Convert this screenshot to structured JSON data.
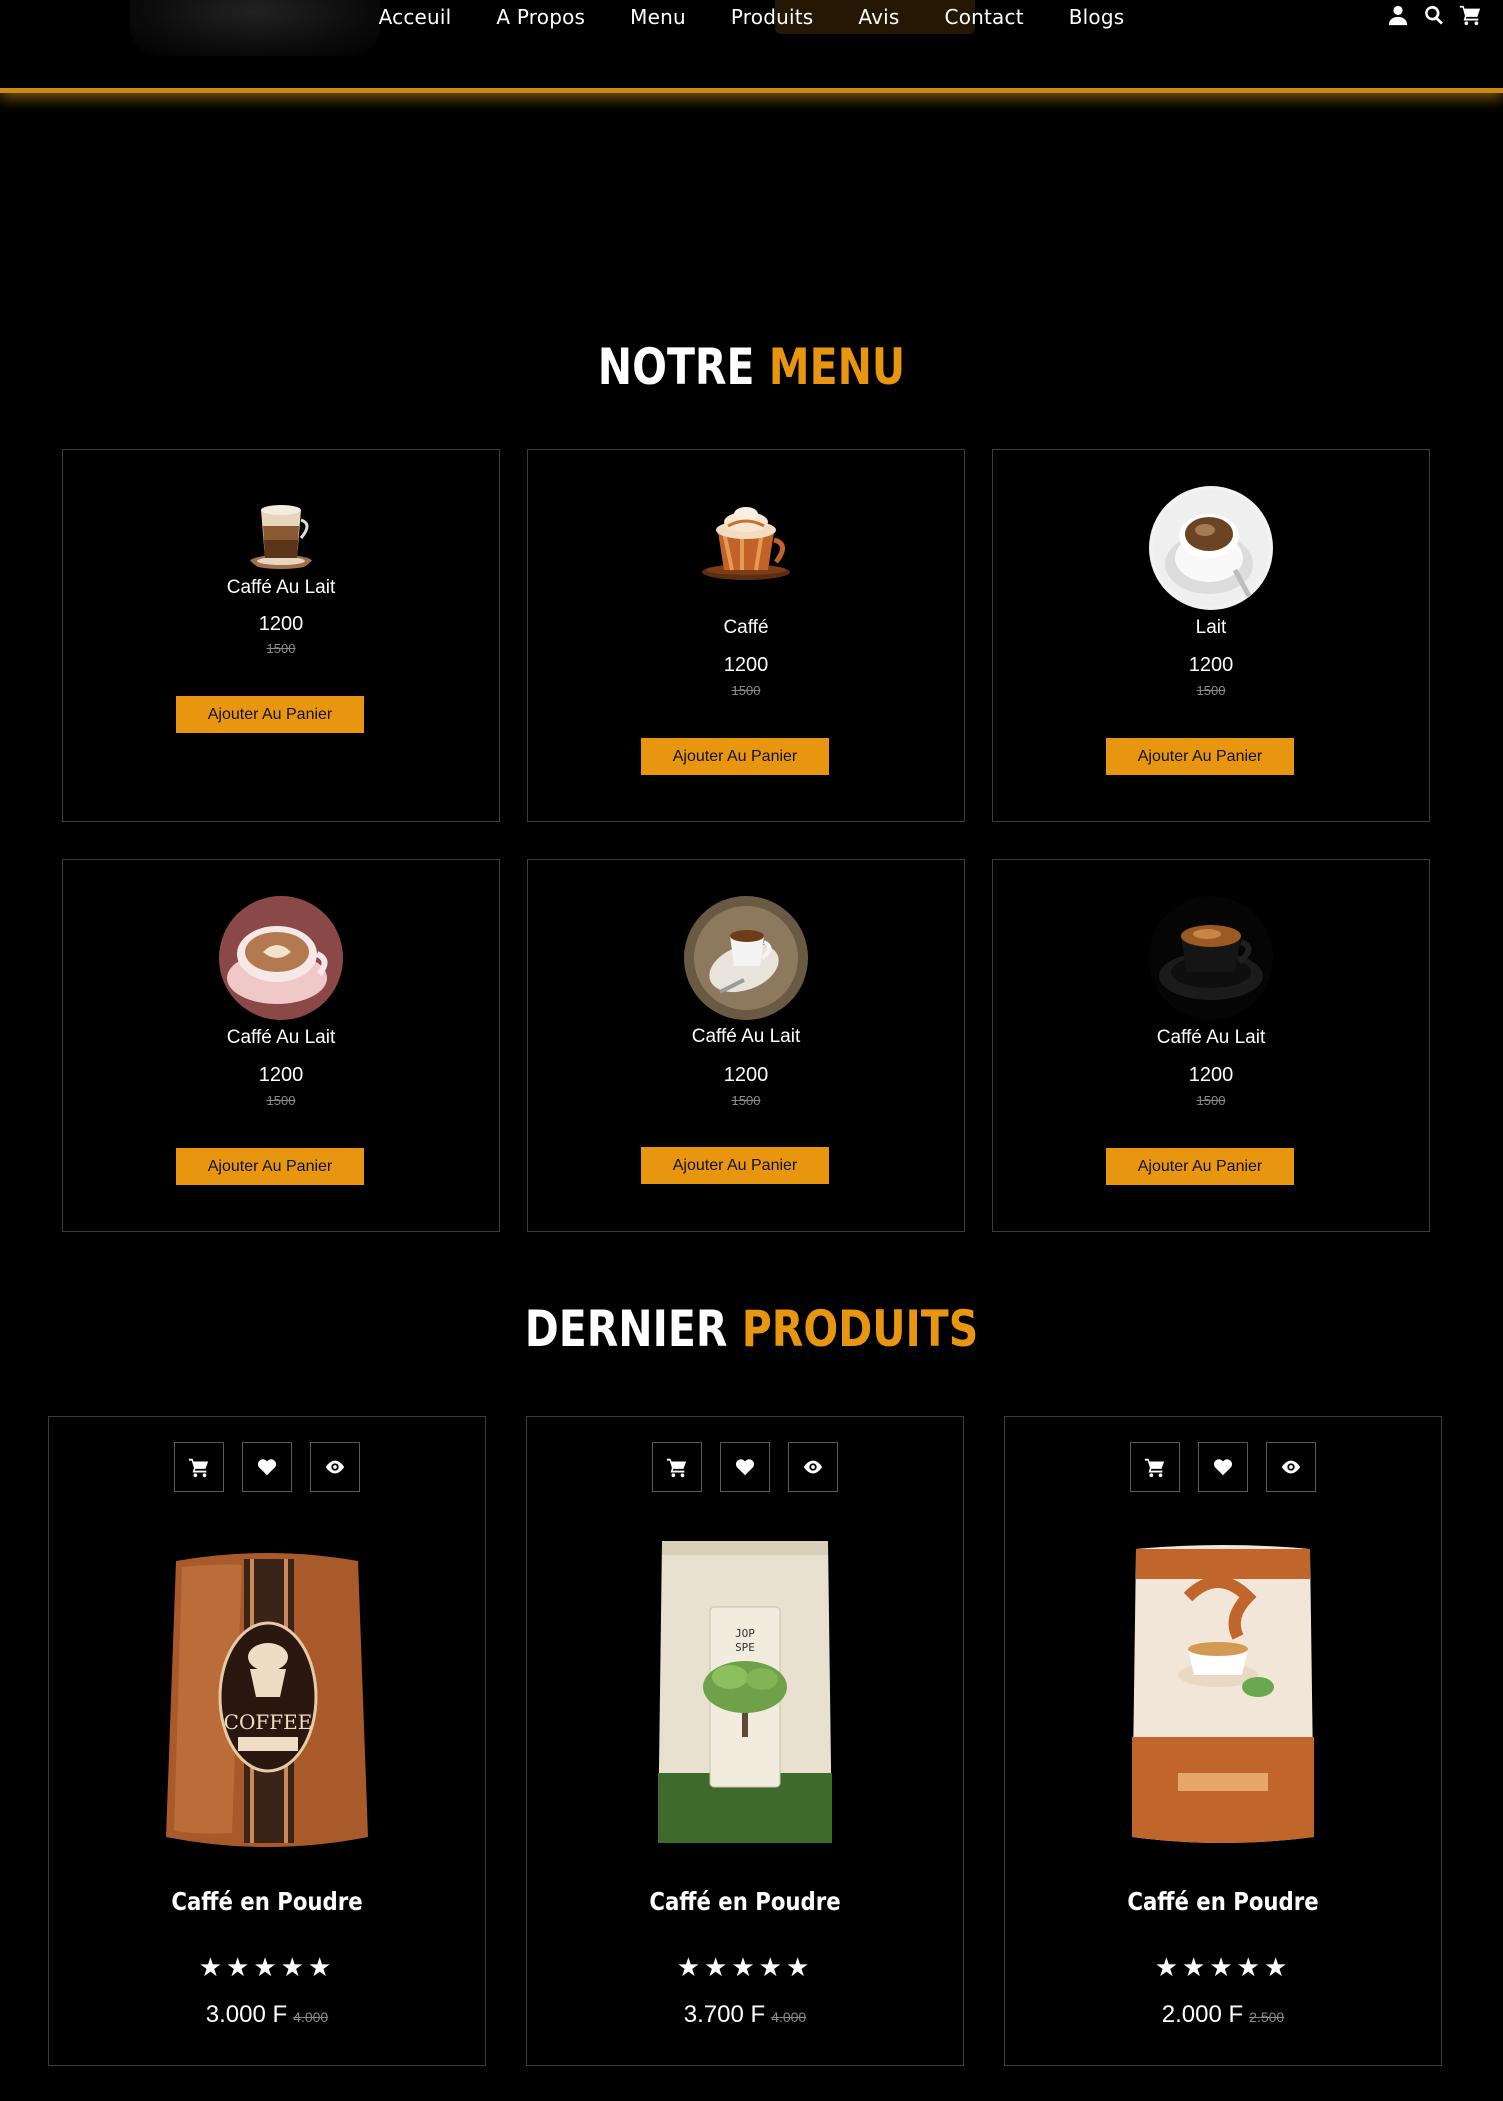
{
  "nav": {
    "links": [
      "Acceuil",
      "A Propos",
      "Menu",
      "Produits",
      "Avis",
      "Contact",
      "Blogs"
    ],
    "icons": [
      "user-icon",
      "search-icon",
      "cart-icon"
    ]
  },
  "menu_section": {
    "title_white": "NOTRE",
    "title_accent": "MENU",
    "items": [
      {
        "name": "Caffé Au Lait",
        "price": "1200",
        "old_price": "1500",
        "button": "Ajouter Au Panier",
        "image": "latte-glass"
      },
      {
        "name": "Caffé",
        "price": "1200",
        "old_price": "1500",
        "button": "Ajouter Au Panier",
        "image": "caramel-cup"
      },
      {
        "name": "Lait",
        "price": "1200",
        "old_price": "1500",
        "button": "Ajouter Au Panier",
        "image": "white-cup"
      },
      {
        "name": "Caffé Au Lait",
        "price": "1200",
        "old_price": "1500",
        "button": "Ajouter Au Panier",
        "image": "latte-art-cup"
      },
      {
        "name": "Caffé Au Lait",
        "price": "1200",
        "old_price": "1500",
        "button": "Ajouter Au Panier",
        "image": "espresso-saucer"
      },
      {
        "name": "Caffé Au Lait",
        "price": "1200",
        "old_price": "1500",
        "button": "Ajouter Au Panier",
        "image": "black-cup"
      }
    ]
  },
  "products_section": {
    "title_white": "DERNIER",
    "title_accent": "PRODUITS",
    "items": [
      {
        "name": "Caffé en Poudre",
        "rating": 5,
        "stars": "★★★★★",
        "price": "3.000 F",
        "old_price": "4.000",
        "image": "coffee-bag-brown"
      },
      {
        "name": "Caffé en Poudre",
        "rating": 5,
        "stars": "★★★★★",
        "price": "3.700 F",
        "old_price": "4.000",
        "image": "coffee-bag-green"
      },
      {
        "name": "Caffé en Poudre",
        "rating": 5,
        "stars": "★★★★★",
        "price": "2.000 F",
        "old_price": "2.500",
        "image": "tea-bag-orange"
      }
    ],
    "actions": [
      "cart-icon",
      "heart-icon",
      "eye-icon"
    ]
  },
  "colors": {
    "accent": "#e8960f",
    "background": "#000000",
    "border": "#3d3d3d"
  }
}
